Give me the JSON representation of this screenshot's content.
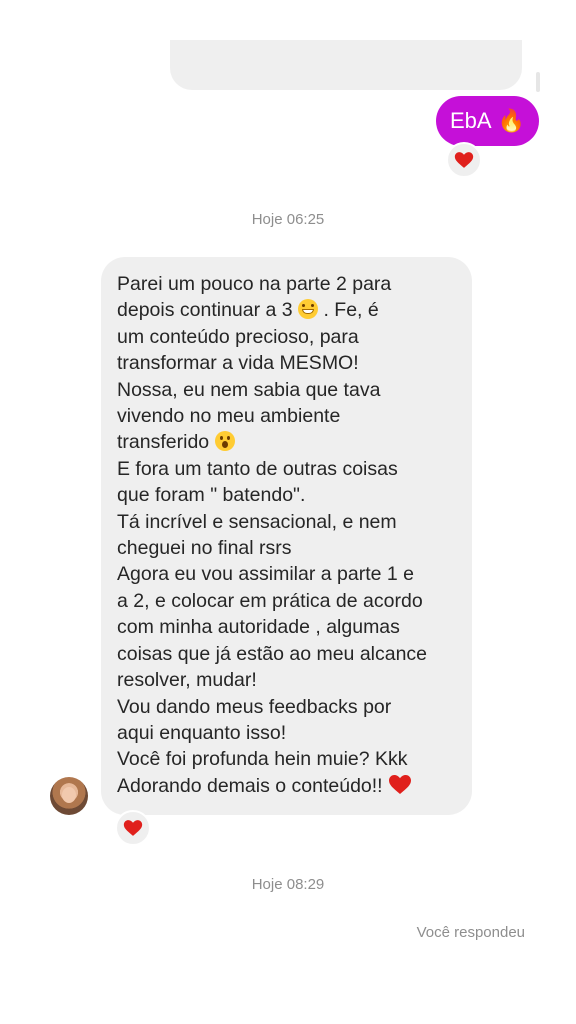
{
  "thread": {
    "sent_message": {
      "text": "EbA",
      "emoji": "fire-emoji",
      "bubble_color": "#c510d8"
    },
    "timestamp_1": "Hoje 06:25",
    "received_message": {
      "lines": [
        "Parei um pouco na parte 2 para",
        "depois continuar a 3",
        ". Fe,  é",
        "um conteúdo precioso, para",
        "transformar a vida MESMO!",
        "Nossa, eu nem sabia que tava",
        "vivendo no meu ambiente",
        "transferido",
        "E fora um tanto de outras coisas",
        "que foram \" batendo\".",
        "Tá incrível e sensacional, e nem",
        "cheguei no final rsrs",
        "Agora eu vou assimilar a parte 1 e",
        "a 2, e colocar em prática de acordo",
        "com minha autoridade , algumas",
        "coisas que já estão ao meu alcance",
        "resolver,  mudar!",
        "Vou dando meus feedbacks por",
        "aqui enquanto isso!",
        "Você foi profunda hein muie? Kkk",
        "Adorando demais o conteúdo!!"
      ],
      "bubble_color": "#efefef"
    },
    "reaction_emoji": "heart-emoji",
    "reaction_color": "#e0201c",
    "timestamp_2": "Hoje 08:29",
    "reply_status": "Você respondeu"
  }
}
